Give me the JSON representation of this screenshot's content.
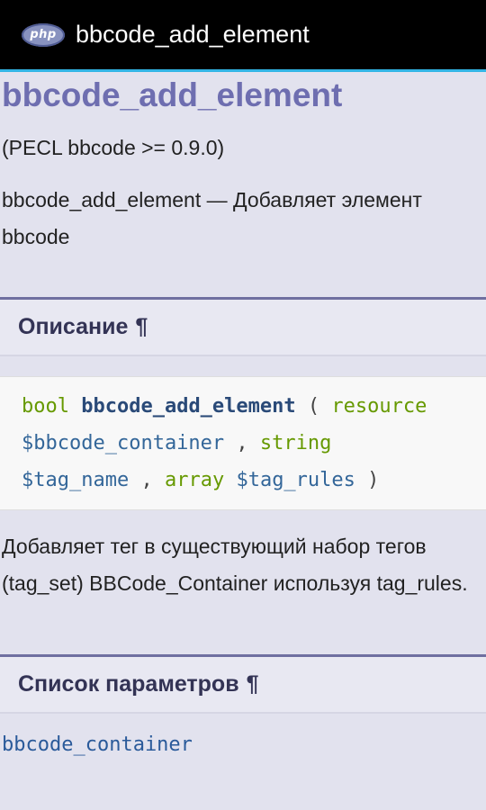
{
  "appbar": {
    "logo_text": "php",
    "title": "bbcode_add_element"
  },
  "page": {
    "refname": "bbcode_add_element",
    "version": "(PECL bbcode >= 0.9.0)",
    "refpurpose": "bbcode_add_element — Добавляет элемент bbcode",
    "description": {
      "title": "Описание",
      "pilcrow": "¶",
      "synopsis": {
        "return_type": "bool",
        "function_name": "bbcode_add_element",
        "open_paren": "(",
        "param1_type": "resource",
        "param1_name": "$bbcode_container",
        "comma1": ",",
        "param2_type": "string",
        "param2_name": "$tag_name",
        "comma2": ",",
        "param3_type": "array",
        "param3_name": "$tag_rules",
        "close_paren": ")"
      },
      "text": "Добавляет тег в существующий набор тегов (tag_set) BBCode_Container используя tag_rules."
    },
    "parameters": {
      "title": "Список параметров",
      "pilcrow": "¶",
      "first_term": "bbcode_container"
    }
  }
}
